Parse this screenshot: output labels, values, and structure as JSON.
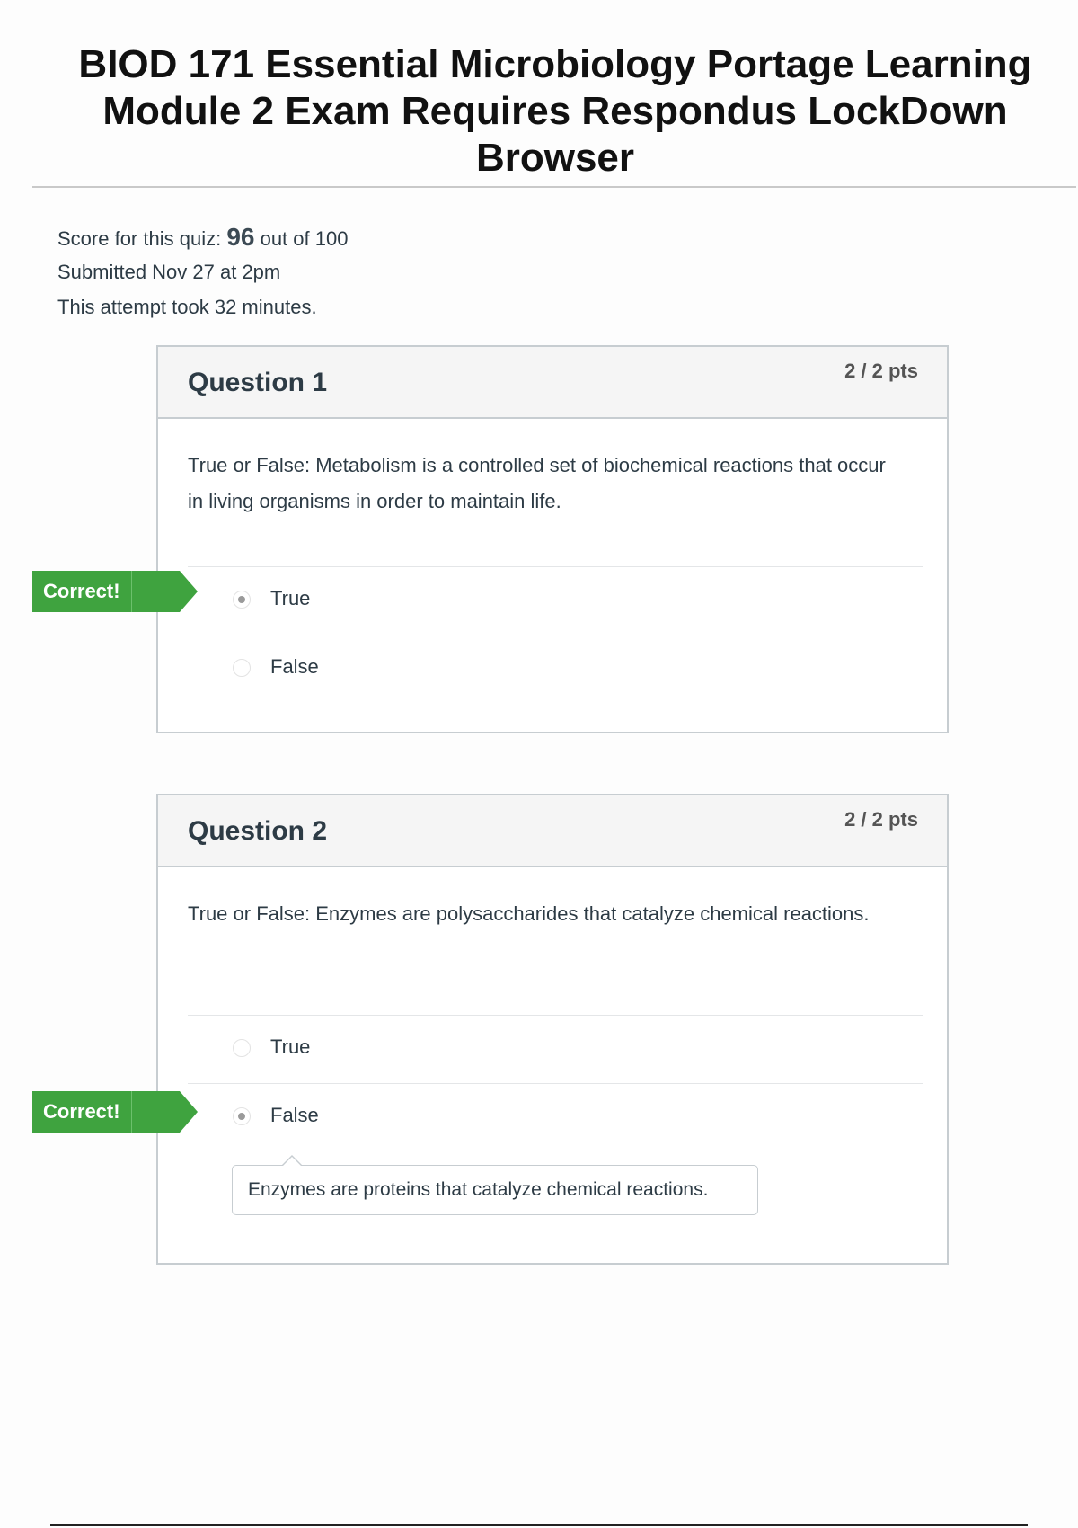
{
  "document": {
    "title": "BIOD 171 Essential Microbiology Portage Learning Module 2 Exam Requires Respondus LockDown Browser"
  },
  "quiz_summary": {
    "score_prefix": "Score for this quiz: ",
    "score": "96",
    "score_suffix": " out of 100",
    "submitted": "Submitted Nov 27 at 2pm",
    "duration": "This attempt took 32 minutes."
  },
  "questions": [
    {
      "title": "Question 1",
      "points": "2 / 2 pts",
      "text": "True or False: Metabolism is a controlled set of biochemical reactions that occur in living organisms in order to maintain life.",
      "answers": [
        {
          "label": "True",
          "selected": true,
          "correct_tag": "Correct!"
        },
        {
          "label": "False",
          "selected": false
        }
      ]
    },
    {
      "title": "Question 2",
      "points": "2 / 2 pts",
      "text": "True or False: Enzymes are polysaccharides that catalyze chemical reactions.",
      "answers": [
        {
          "label": "True",
          "selected": false
        },
        {
          "label": "False",
          "selected": true,
          "correct_tag": "Correct!"
        }
      ],
      "comment": "Enzymes are proteins that catalyze chemical reactions."
    }
  ],
  "colors": {
    "correct_tag": "#3fa33f",
    "header_bg": "#f5f5f5",
    "border": "#c7cdd1",
    "text": "#2d3b45"
  }
}
